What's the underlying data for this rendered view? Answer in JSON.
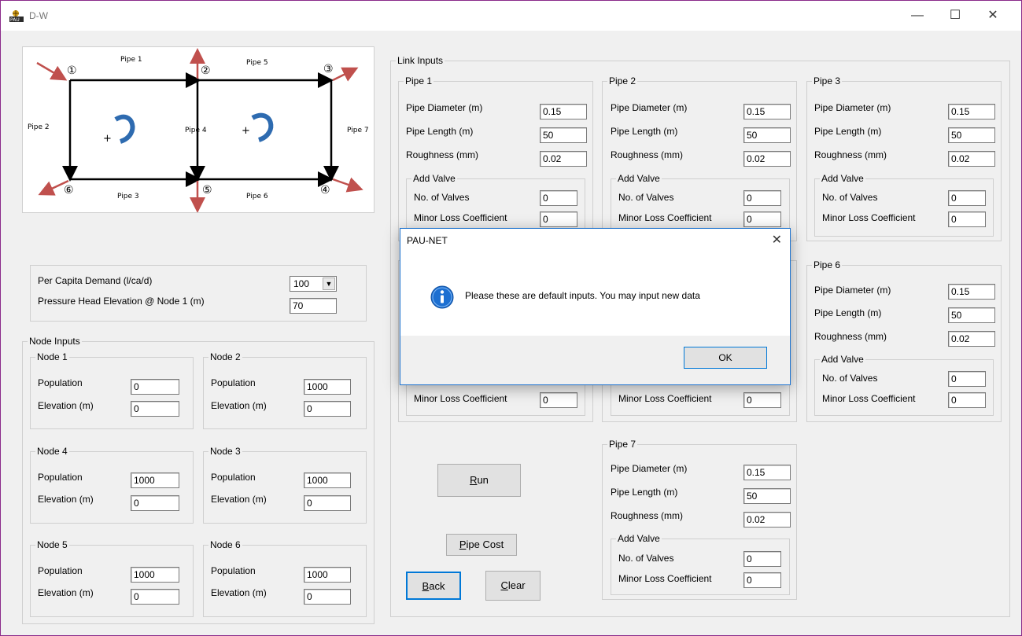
{
  "window": {
    "title": "D-W",
    "minimize": "—",
    "maximize": "☐",
    "close": "✕"
  },
  "diagram": {
    "nodes": [
      "①",
      "②",
      "③",
      "④",
      "⑤",
      "⑥"
    ],
    "pipes": [
      "Pipe 1",
      "Pipe 2",
      "Pipe 3",
      "Pipe 4",
      "Pipe 5",
      "Pipe 6",
      "Pipe 7"
    ],
    "plus": "+"
  },
  "demand": {
    "per_capita_label": "Per Capita Demand (l/ca/d)",
    "per_capita_value": "100",
    "pressure_label": "Pressure Head Elevation @ Node 1 (m)",
    "pressure_value": "70"
  },
  "node_inputs": {
    "legend": "Node Inputs",
    "population_label": "Population",
    "elevation_label": "Elevation (m)",
    "nodes": [
      {
        "legend": "Node 1",
        "population": "0",
        "elevation": "0"
      },
      {
        "legend": "Node 2",
        "population": "1000",
        "elevation": "0"
      },
      {
        "legend": "Node 4",
        "population": "1000",
        "elevation": "0"
      },
      {
        "legend": "Node 3",
        "population": "1000",
        "elevation": "0"
      },
      {
        "legend": "Node 5",
        "population": "1000",
        "elevation": "0"
      },
      {
        "legend": "Node 6",
        "population": "1000",
        "elevation": "0"
      }
    ]
  },
  "link_inputs": {
    "legend": "Link Inputs",
    "diameter_label": "Pipe Diameter (m)",
    "length_label": "Pipe Length (m)",
    "roughness_label": "Roughness (mm)",
    "valve_legend": "Add Valve",
    "valves_label": "No. of Valves",
    "minor_loss_label": "Minor Loss Coefficient",
    "pipes": [
      {
        "legend": "Pipe 1",
        "diameter": "0.15",
        "length": "50",
        "roughness": "0.02",
        "valves": "0",
        "minor": "0"
      },
      {
        "legend": "Pipe 2",
        "diameter": "0.15",
        "length": "50",
        "roughness": "0.02",
        "valves": "0",
        "minor": "0"
      },
      {
        "legend": "Pipe 3",
        "diameter": "0.15",
        "length": "50",
        "roughness": "0.02",
        "valves": "0",
        "minor": "0"
      },
      {
        "legend": "Pipe 6",
        "diameter": "0.15",
        "length": "50",
        "roughness": "0.02",
        "valves": "0",
        "minor": "0"
      },
      {
        "legend": "Pipe 7",
        "diameter": "0.15",
        "length": "50",
        "roughness": "0.02",
        "valves": "0",
        "minor": "0"
      }
    ],
    "pipe4_minor": "0",
    "pipe5_minor": "0"
  },
  "buttons": {
    "run_u": "R",
    "run_rest": "un",
    "pipe_cost_u": "P",
    "pipe_cost_rest": "ipe Cost",
    "back_u": "B",
    "back_rest": "ack",
    "clear_u": "C",
    "clear_rest": "lear"
  },
  "dialog": {
    "title": "PAU-NET",
    "close": "✕",
    "message": "Please these are default inputs. You may input new data",
    "ok": "OK"
  }
}
